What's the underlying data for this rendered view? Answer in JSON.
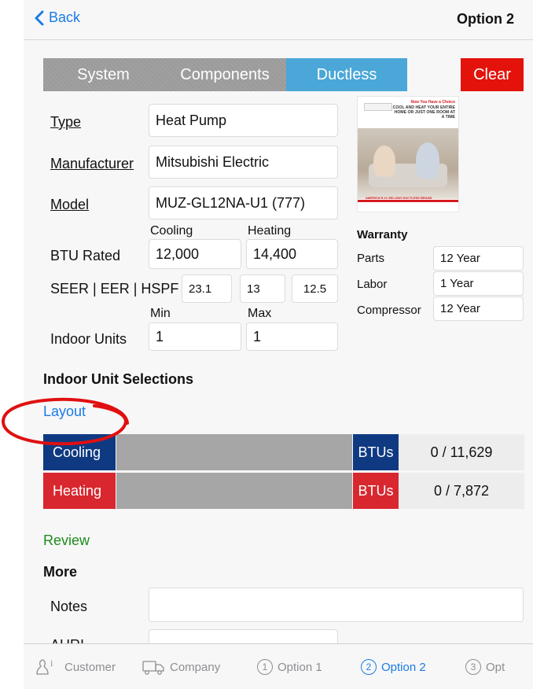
{
  "nav": {
    "back_label": "Back",
    "title": "Option 2"
  },
  "segments": {
    "system": "System",
    "components": "Components",
    "ductless": "Ductless",
    "clear": "Clear",
    "active": "Ductless"
  },
  "form": {
    "type_label": "Type",
    "type_value": "Heat Pump",
    "manufacturer_label": "Manufacturer",
    "manufacturer_value": "Mitsubishi Electric",
    "model_label": "Model",
    "model_value": "MUZ-GL12NA-U1 (777)",
    "cooling_header": "Cooling",
    "heating_header": "Heating",
    "btu_label": "BTU Rated",
    "btu_cooling": "12,000",
    "btu_heating": "14,400",
    "seer_label": "SEER | EER | HSPF",
    "seer": "23.1",
    "eer": "13",
    "hspf": "12.5",
    "min_header": "Min",
    "max_header": "Max",
    "indoor_units_label": "Indoor Units",
    "indoor_min": "1",
    "indoor_max": "1"
  },
  "promo": {
    "kicker": "Now You Have a Choice",
    "headline": "COOL AND HEAT YOUR ENTIRE HOME OR JUST ONE ROOM AT A TIME",
    "footer": "AMERICA'S #1 SELLING DUCTLESS BRAND"
  },
  "warranty": {
    "title": "Warranty",
    "rows": [
      {
        "label": "Parts",
        "value": "12 Year"
      },
      {
        "label": "Labor",
        "value": "1 Year"
      },
      {
        "label": "Compressor",
        "value": "12 Year"
      }
    ]
  },
  "indoor": {
    "section_title": "Indoor Unit Selections",
    "layout_link": "Layout",
    "cooling": {
      "label": "Cooling",
      "unit": "BTUs",
      "value": "0 / 11,629",
      "fill": 0
    },
    "heating": {
      "label": "Heating",
      "unit": "BTUs",
      "value": "0 / 7,872",
      "fill": 0
    }
  },
  "review_link": "Review",
  "more": {
    "title": "More",
    "notes_label": "Notes",
    "notes_value": "",
    "ahri_label": "AHRI",
    "ahri_value": ""
  },
  "tabs": [
    {
      "label": "Customer",
      "icon": "customer-icon"
    },
    {
      "label": "Company",
      "icon": "truck-icon"
    },
    {
      "label": "Option 1",
      "num": "1"
    },
    {
      "label": "Option 2",
      "num": "2",
      "active": true
    },
    {
      "label": "Opt",
      "num": "3"
    }
  ],
  "colors": {
    "accent": "#1a7be7",
    "cooling": "#0f3a82",
    "heating": "#d8272e",
    "ductless": "#4aa7d8",
    "clear": "#e3120b",
    "review": "#1c8c1c",
    "annotation": "#e01010"
  }
}
